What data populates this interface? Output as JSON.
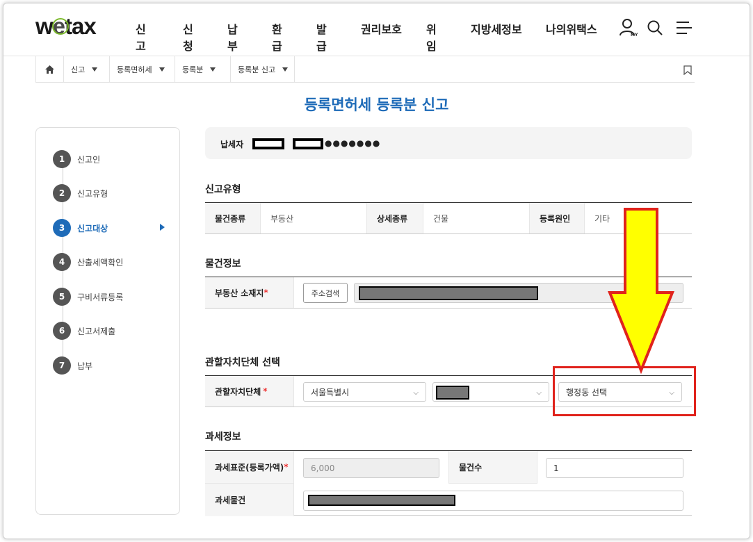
{
  "header": {
    "logo": "wetax",
    "logo_w": "w",
    "logo_e": "e",
    "logo_rest": "tax",
    "nav": [
      "신고",
      "신청",
      "납부",
      "환급",
      "발급",
      "권리보호",
      "위임",
      "지방세정보",
      "나의위택스"
    ],
    "my_label": "MY"
  },
  "breadcrumb": {
    "items": [
      "신고",
      "등록면허세",
      "등록분",
      "등록분 신고"
    ]
  },
  "page_title": "등록면허세 등록분 신고",
  "steps": [
    {
      "num": "1",
      "label": "신고인"
    },
    {
      "num": "2",
      "label": "신고유형"
    },
    {
      "num": "3",
      "label": "신고대상"
    },
    {
      "num": "4",
      "label": "산출세액확인"
    },
    {
      "num": "5",
      "label": "구비서류등록"
    },
    {
      "num": "6",
      "label": "신고서제출"
    },
    {
      "num": "7",
      "label": "납부"
    }
  ],
  "taxpayer": {
    "label": "납세자",
    "masked": "●●●●●●●"
  },
  "report_type": {
    "title": "신고유형",
    "kind_label": "물건종류",
    "kind_value": "부동산",
    "detail_label": "상세종류",
    "detail_value": "건물",
    "cause_label": "등록원인",
    "cause_value": "기타"
  },
  "property": {
    "title": "물건정보",
    "location_label": "부동산 소재지",
    "required": "*",
    "search_button": "주소검색"
  },
  "jurisdiction": {
    "title": "관할자치단체 선택",
    "label": "관할자치단체",
    "required": "*",
    "city": "서울특별시",
    "district_placeholder": "",
    "dong_placeholder": "행정동 선택"
  },
  "tax_info": {
    "title": "과세정보",
    "base_label": "과세표준(등록가액)",
    "required": "*",
    "base_value": "6,000",
    "count_label": "물건수",
    "count_value": "1",
    "object_label": "과세물건"
  },
  "colors": {
    "accent": "#1e6bb8",
    "annotation_red": "#e0231c",
    "annotation_yellow": "#ffff00"
  }
}
